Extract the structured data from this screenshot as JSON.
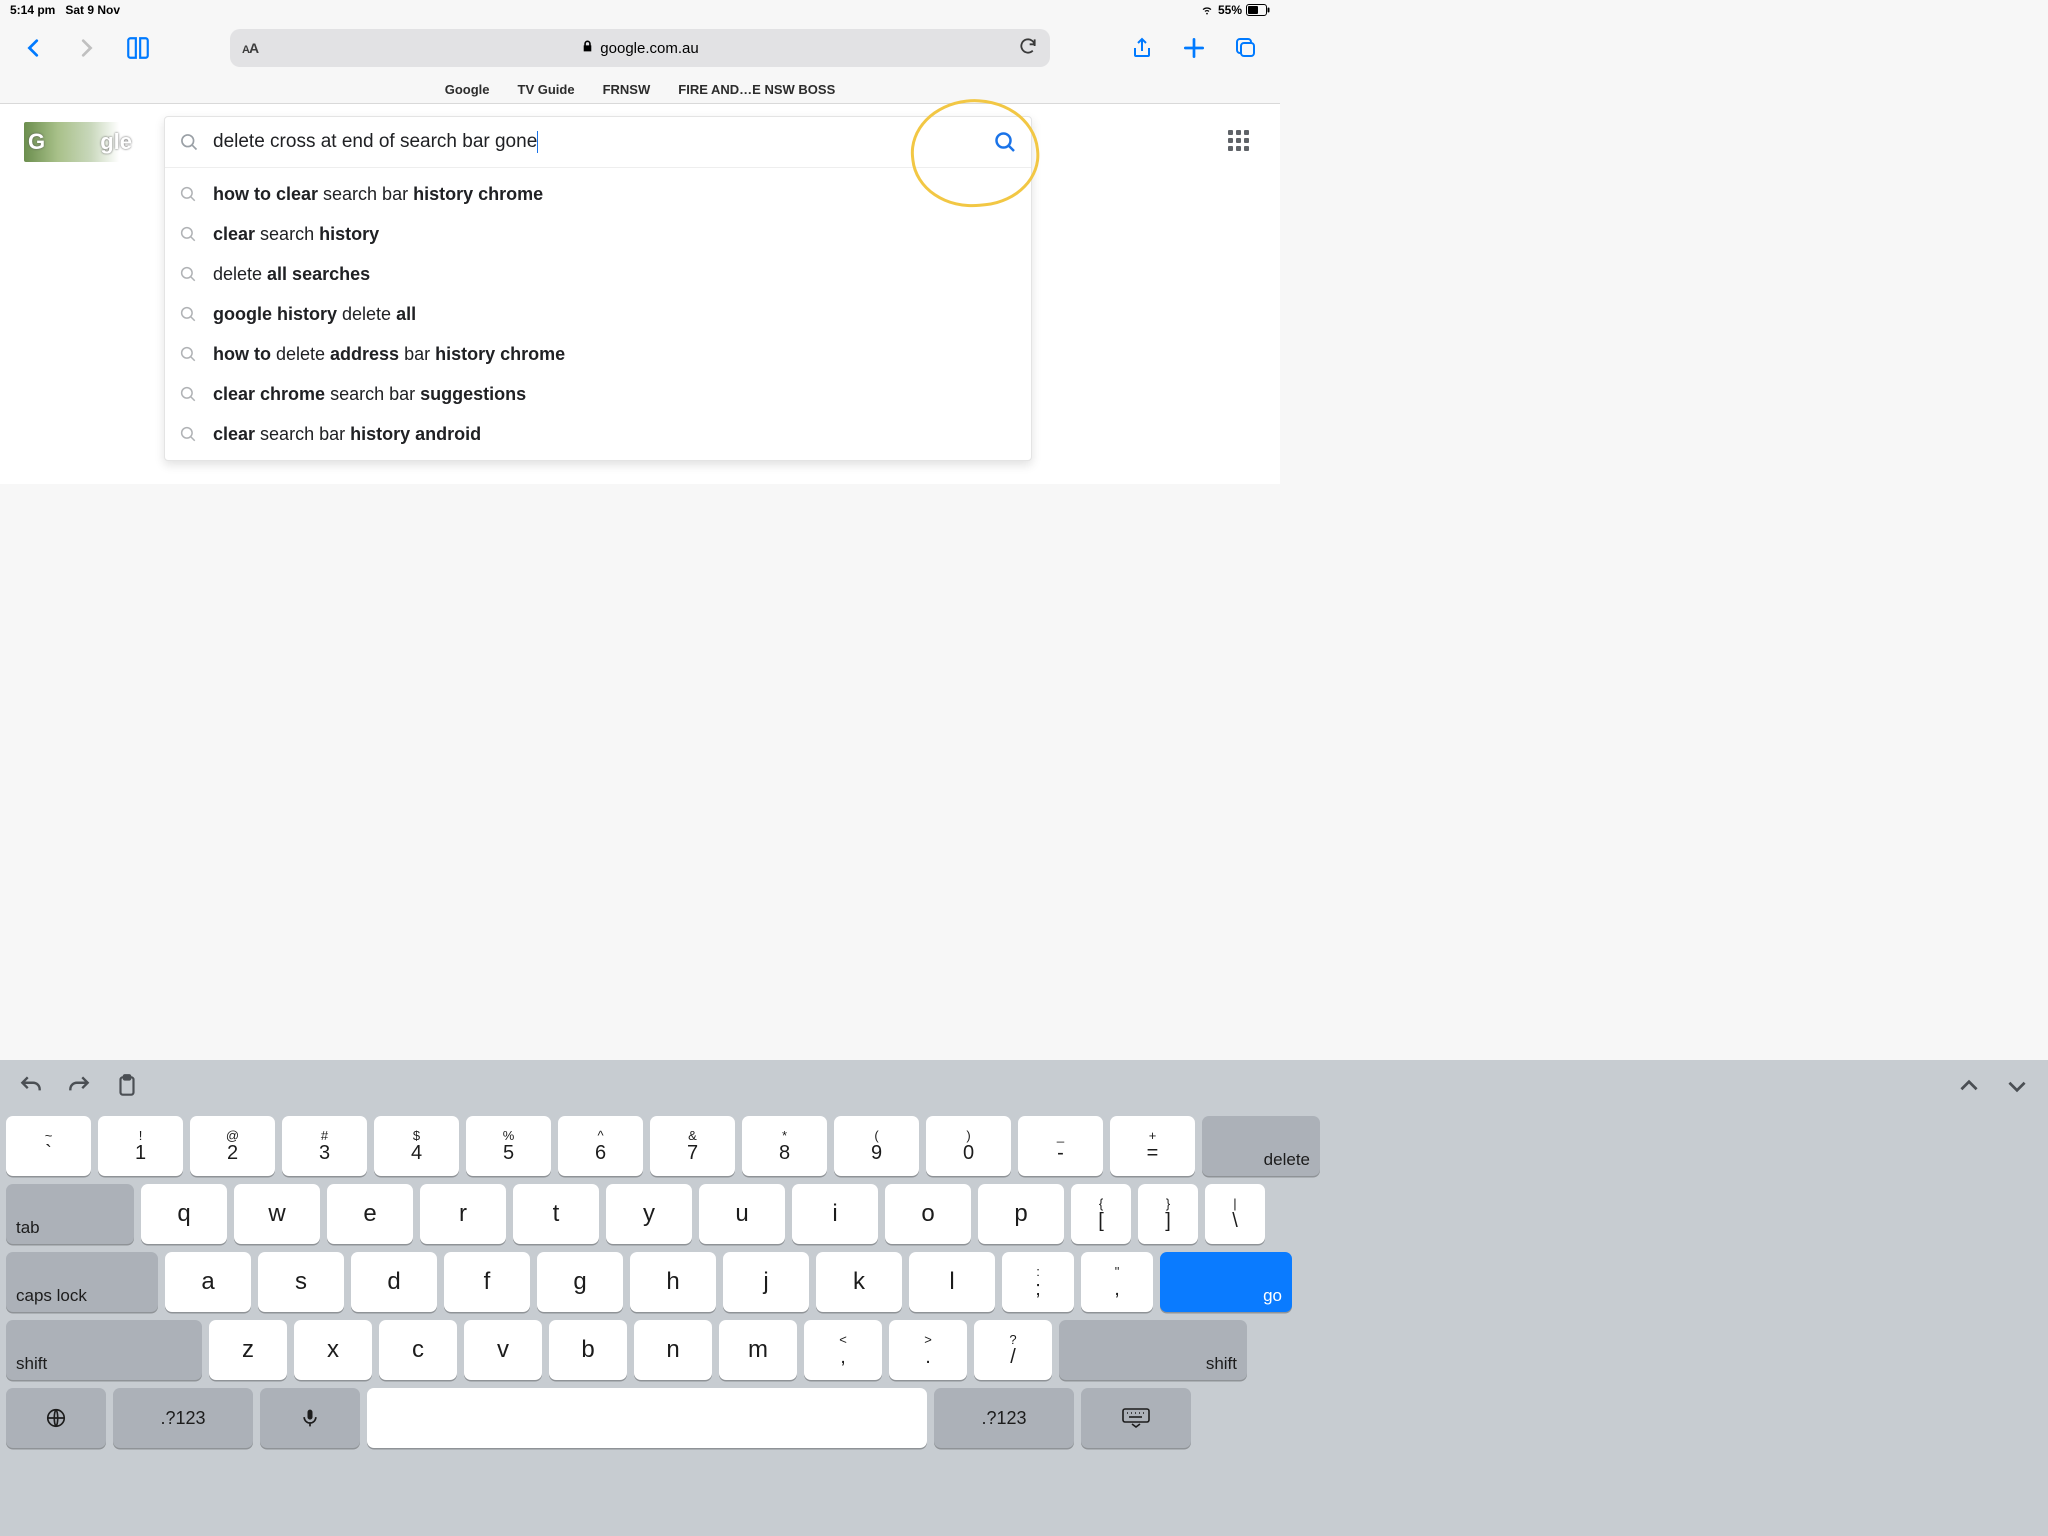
{
  "status": {
    "time": "5:14 pm",
    "date": "Sat 9 Nov",
    "battery": "55%"
  },
  "address": {
    "domain": "google.com.au",
    "aa": "AA"
  },
  "favorites": [
    "Google",
    "TV Guide",
    "FRNSW",
    "FIRE AND…E NSW BOSS"
  ],
  "logo": {
    "left": "G",
    "right": "gle"
  },
  "search": {
    "query": "delete cross at end of search bar gone"
  },
  "suggestions": [
    [
      [
        "how to clear",
        true
      ],
      [
        " search bar ",
        false
      ],
      [
        "history chrome",
        true
      ]
    ],
    [
      [
        "clear",
        true
      ],
      [
        " search ",
        false
      ],
      [
        "history",
        true
      ]
    ],
    [
      [
        "delete ",
        false
      ],
      [
        "all searches",
        true
      ]
    ],
    [
      [
        "google history",
        true
      ],
      [
        " delete ",
        false
      ],
      [
        "all",
        true
      ]
    ],
    [
      [
        "how to",
        true
      ],
      [
        " delete ",
        false
      ],
      [
        "address",
        true
      ],
      [
        " bar ",
        false
      ],
      [
        "history chrome",
        true
      ]
    ],
    [
      [
        "clear chrome",
        true
      ],
      [
        " search bar ",
        false
      ],
      [
        "suggestions",
        true
      ]
    ],
    [
      [
        "clear",
        true
      ],
      [
        " search bar ",
        false
      ],
      [
        "history android",
        true
      ]
    ]
  ],
  "keyboard": {
    "row1": [
      {
        "u": "~",
        "l": "`"
      },
      {
        "u": "!",
        "l": "1"
      },
      {
        "u": "@",
        "l": "2"
      },
      {
        "u": "#",
        "l": "3"
      },
      {
        "u": "$",
        "l": "4"
      },
      {
        "u": "%",
        "l": "5"
      },
      {
        "u": "^",
        "l": "6"
      },
      {
        "u": "&",
        "l": "7"
      },
      {
        "u": "*",
        "l": "8"
      },
      {
        "u": "(",
        "l": "9"
      },
      {
        "u": ")",
        "l": "0"
      },
      {
        "u": "_",
        "l": "-"
      },
      {
        "u": "+",
        "l": "="
      }
    ],
    "delete": "delete",
    "tab": "tab",
    "row2": [
      "q",
      "w",
      "e",
      "r",
      "t",
      "y",
      "u",
      "i",
      "o",
      "p"
    ],
    "row2b": [
      {
        "u": "{",
        "l": "["
      },
      {
        "u": "}",
        "l": "]"
      },
      {
        "u": "|",
        "l": "\\"
      }
    ],
    "caps": "caps lock",
    "row3": [
      "a",
      "s",
      "d",
      "f",
      "g",
      "h",
      "j",
      "k",
      "l"
    ],
    "row3b": [
      {
        "u": ":",
        "l": ";"
      },
      {
        "u": "\"",
        "l": ","
      }
    ],
    "go": "go",
    "shift": "shift",
    "row4": [
      "z",
      "x",
      "c",
      "v",
      "b",
      "n",
      "m"
    ],
    "row4b": [
      {
        "u": "<",
        "l": ","
      },
      {
        "u": ">",
        "l": "."
      },
      {
        "u": "?",
        "l": "/"
      }
    ],
    "alt": ".?123"
  }
}
